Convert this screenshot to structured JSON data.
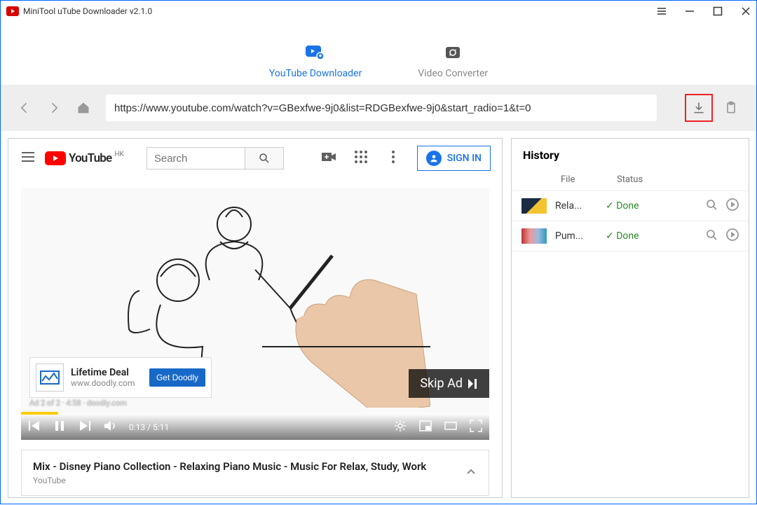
{
  "window": {
    "title": "MiniTool uTube Downloader v2.1.0"
  },
  "modes": {
    "downloader_label": "YouTube Downloader",
    "converter_label": "Video Converter"
  },
  "urlbar": {
    "value": "https://www.youtube.com/watch?v=GBexfwe-9j0&list=RDGBexfwe-9j0&start_radio=1&t=0"
  },
  "youtube": {
    "region": "HK",
    "brand": "YouTube",
    "search_placeholder": "Search",
    "sign_in": "SIGN IN"
  },
  "player": {
    "ad_card_title": "Lifetime Deal",
    "ad_card_host": "www.doodly.com",
    "ad_cta": "Get Doodly",
    "ad_meta": "Ad 2 of 2 · 4:58 · doodly.com",
    "skip_ad": "Skip Ad",
    "time": "0:13 / 5:11"
  },
  "video": {
    "title": "Mix - Disney Piano Collection - Relaxing Piano Music - Music For Relax, Study, Work",
    "subtitle": "YouTube"
  },
  "history": {
    "title": "History",
    "col_file": "File",
    "col_status": "Status",
    "done_label": "✓ Done",
    "items": [
      {
        "file": "Rela..."
      },
      {
        "file": "Pum..."
      }
    ]
  }
}
